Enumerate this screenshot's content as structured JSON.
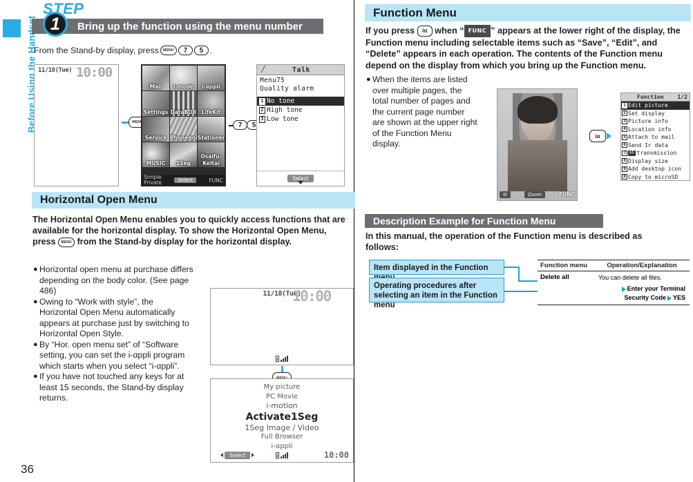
{
  "sidebar": {
    "chapter_label": "Before Using the Handset",
    "accent_color": "#29ace3"
  },
  "page_number": "36",
  "left": {
    "step": {
      "word": "STEP",
      "number": "1",
      "title": "Bring up the function using the menu number"
    },
    "instruction": {
      "prefix": "From the Stand-by display, press",
      "keys": [
        "MENU",
        "7",
        "5"
      ],
      "suffix": "."
    },
    "standby_screen": {
      "date": "11/18(Tue)",
      "time": "10:00"
    },
    "menu_screen": {
      "items": [
        {
          "label": "Mail",
          "selected": false
        },
        {
          "label": "i-mode",
          "selected": false
        },
        {
          "label": "i-αppli",
          "selected": false
        },
        {
          "label": "Settings",
          "selected": false
        },
        {
          "label": "DataBOX",
          "selected": true
        },
        {
          "label": "LifeKit",
          "selected": false
        },
        {
          "label": "Service",
          "selected": false
        },
        {
          "label": "Phonebook",
          "selected": false
        },
        {
          "label": "Stationery",
          "selected": false
        },
        {
          "label": "MUSIC",
          "selected": false
        },
        {
          "label": "1Seg",
          "selected": false
        },
        {
          "label": "Osaifu-Keitai",
          "selected": false
        }
      ],
      "softkey_left_line1": "Simple",
      "softkey_left_line2": "Private",
      "softkey_center": "Select",
      "softkey_right": "FUNC"
    },
    "talk_screen": {
      "title": "Talk",
      "subtitle_line1": "Menu75",
      "subtitle_line2": "Quality alarm",
      "options": [
        {
          "num": "1",
          "label": "No tone",
          "selected": true
        },
        {
          "num": "2",
          "label": "High tone",
          "selected": false
        },
        {
          "num": "3",
          "label": "Low tone",
          "selected": false
        }
      ],
      "softkey_center": "Select"
    },
    "horizontal_section": {
      "heading": "Horizontal Open Menu",
      "paragraph_part1": "The Horizontal Open Menu enables you to quickly access functions that are available for the horizontal display. To show the Horizontal Open Menu, press",
      "paragraph_key": "MENU",
      "paragraph_part2": "from the Stand-by display for the horizontal display.",
      "bullets": [
        "Horizontal open menu at purchase differs depending on the body color. (See page 486)",
        "Owing to “Work with style”, the Horizontal Open Menu automatically appears at purchase just by switching to Horizontal Open Style.",
        "By “Hor. open menu set” of “Software setting, you can set the i-αppli program which starts when you select “i-αppli”.",
        "If you have not touched any keys for at least 15 seconds, the Stand-by display returns."
      ]
    },
    "h_standby_screen": {
      "date": "11/18(Tue)",
      "time": "10:00"
    },
    "h_menu_screen": {
      "items": [
        {
          "label": "My picture",
          "focus": false
        },
        {
          "label": "PC Movie",
          "focus": false
        },
        {
          "label": "i-motion",
          "focus": false
        },
        {
          "label": "Activate1Seg",
          "focus": true
        },
        {
          "label": "1Seg Image / Video",
          "focus": false
        },
        {
          "label": "Full Browser",
          "focus": false
        },
        {
          "label": "i-αppli",
          "focus": false
        }
      ],
      "softkey_center": "Select",
      "clock": "10:00"
    },
    "menu_key_label": "MENU"
  },
  "right": {
    "function_menu_section": {
      "heading": "Function Menu",
      "intro_part1": "If you press",
      "intro_key": "iα",
      "intro_part2": "when “",
      "intro_tag": "FUNC",
      "intro_part3": "” appears at the lower right of the display, the Function menu including selectable items such as “Save”, “Edit”, and “Delete” appears in each operation. The contents of the Function menu depend on the display from which you bring up the Function menu.",
      "bullet": "When the items are listed over multiple pages, the total number of pages and the current page number are shown at the upper right of the Function Menu display."
    },
    "photo_screen": {
      "softkey_left": "mail-icon",
      "softkey_center": "Zoom",
      "softkey_right": "FUNC"
    },
    "function_screen": {
      "title": "Function",
      "page_indicator": "1/2",
      "items": [
        {
          "num": "1",
          "label": "Edit picture",
          "selected": true
        },
        {
          "num": "2",
          "label": "Set display",
          "selected": false
        },
        {
          "num": "3",
          "label": "Picture info",
          "selected": false
        },
        {
          "num": "4",
          "label": "Location info",
          "selected": false
        },
        {
          "num": "5",
          "label": "Attach to mail",
          "selected": false
        },
        {
          "num": "6",
          "label": "Send Ir data",
          "selected": false
        },
        {
          "num": "7",
          "label": "transmission",
          "icon": "iC",
          "selected": false
        },
        {
          "num": "8",
          "label": "Display size",
          "selected": false
        },
        {
          "num": "9",
          "label": "Add desktop icon",
          "selected": false
        },
        {
          "num": "0",
          "label": "Copy to microSD",
          "selected": false
        }
      ]
    },
    "description_section": {
      "heading": "Description Example for Function Menu",
      "intro": "In this manual, the operation of the Function menu is described as follows:",
      "callout_1": "Item displayed in the Function menu",
      "callout_2": "Operating procedures after selecting an item in the Function menu",
      "table": {
        "headers": [
          "Function menu",
          "Operation/Explanation"
        ],
        "row": {
          "item": "Delete all",
          "explanation_line1": "You can delete all files.",
          "explanation_line2_a": "Enter your Terminal Security Code",
          "explanation_line2_b": "YES"
        }
      }
    }
  }
}
